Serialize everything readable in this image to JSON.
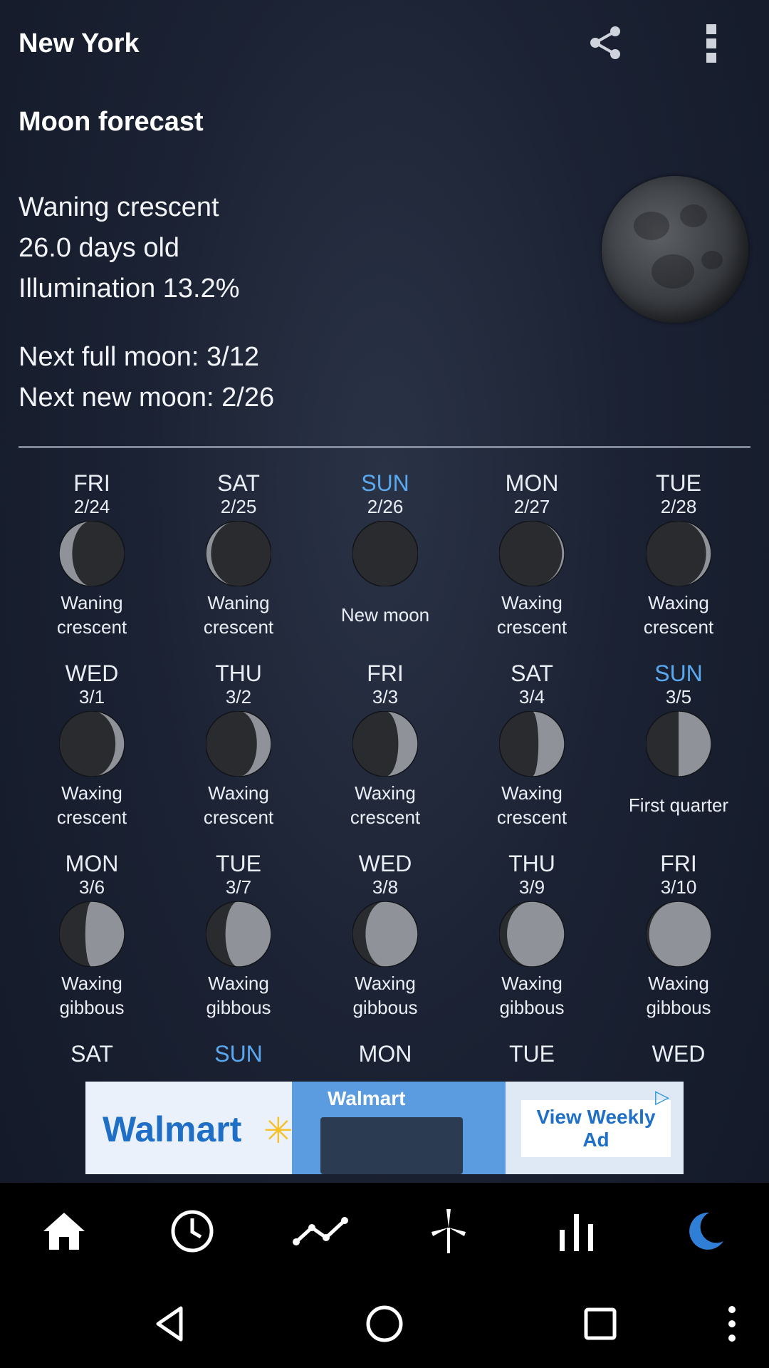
{
  "header": {
    "city": "New York",
    "share_icon": "share-icon",
    "menu_icon": "more-vert-icon"
  },
  "forecast": {
    "title": "Moon forecast",
    "phase": "Waning crescent",
    "age": "26.0 days old",
    "illumination_label": "Illumination",
    "illumination_value": "13.2%",
    "next_full_label": "Next full moon:",
    "next_full_value": "3/12",
    "next_new_label": "Next new moon:",
    "next_new_value": "2/26"
  },
  "days": [
    {
      "day": "FRI",
      "date": "2/24",
      "phase": "Waning crescent",
      "illum": 0.2,
      "waxing": false,
      "sunday": false
    },
    {
      "day": "SAT",
      "date": "2/25",
      "phase": "Waning crescent",
      "illum": 0.08,
      "waxing": false,
      "sunday": false
    },
    {
      "day": "SUN",
      "date": "2/26",
      "phase": "New moon",
      "illum": 0.0,
      "waxing": true,
      "sunday": true
    },
    {
      "day": "MON",
      "date": "2/27",
      "phase": "Waxing crescent",
      "illum": 0.04,
      "waxing": true,
      "sunday": false
    },
    {
      "day": "TUE",
      "date": "2/28",
      "phase": "Waxing crescent",
      "illum": 0.08,
      "waxing": true,
      "sunday": false
    },
    {
      "day": "WED",
      "date": "3/1",
      "phase": "Waxing crescent",
      "illum": 0.14,
      "waxing": true,
      "sunday": false
    },
    {
      "day": "THU",
      "date": "3/2",
      "phase": "Waxing crescent",
      "illum": 0.22,
      "waxing": true,
      "sunday": false
    },
    {
      "day": "FRI",
      "date": "3/3",
      "phase": "Waxing crescent",
      "illum": 0.3,
      "waxing": true,
      "sunday": false
    },
    {
      "day": "SAT",
      "date": "3/4",
      "phase": "Waxing crescent",
      "illum": 0.4,
      "waxing": true,
      "sunday": false
    },
    {
      "day": "SUN",
      "date": "3/5",
      "phase": "First quarter",
      "illum": 0.5,
      "waxing": true,
      "sunday": true
    },
    {
      "day": "MON",
      "date": "3/6",
      "phase": "Waxing gibbous",
      "illum": 0.6,
      "waxing": true,
      "sunday": false
    },
    {
      "day": "TUE",
      "date": "3/7",
      "phase": "Waxing gibbous",
      "illum": 0.7,
      "waxing": true,
      "sunday": false
    },
    {
      "day": "WED",
      "date": "3/8",
      "phase": "Waxing gibbous",
      "illum": 0.8,
      "waxing": true,
      "sunday": false
    },
    {
      "day": "THU",
      "date": "3/9",
      "phase": "Waxing gibbous",
      "illum": 0.88,
      "waxing": true,
      "sunday": false
    },
    {
      "day": "FRI",
      "date": "3/10",
      "phase": "Waxing gibbous",
      "illum": 0.95,
      "waxing": true,
      "sunday": false
    },
    {
      "day": "SAT",
      "date": "",
      "phase": "",
      "illum": null,
      "waxing": true,
      "sunday": false
    },
    {
      "day": "SUN",
      "date": "",
      "phase": "",
      "illum": null,
      "waxing": true,
      "sunday": true
    },
    {
      "day": "MON",
      "date": "",
      "phase": "",
      "illum": null,
      "waxing": true,
      "sunday": false
    },
    {
      "day": "TUE",
      "date": "",
      "phase": "",
      "illum": null,
      "waxing": true,
      "sunday": false
    },
    {
      "day": "WED",
      "date": "",
      "phase": "",
      "illum": null,
      "waxing": true,
      "sunday": false
    }
  ],
  "ad": {
    "brand": "Walmart",
    "button": "View Weekly Ad",
    "icon": "ad-choices-icon"
  },
  "bottom_nav": [
    {
      "name": "home",
      "icon": "home-icon",
      "active": false
    },
    {
      "name": "hourly",
      "icon": "clock-icon",
      "active": false
    },
    {
      "name": "graph",
      "icon": "trend-icon",
      "active": false
    },
    {
      "name": "wind",
      "icon": "wind-turbine-icon",
      "active": false
    },
    {
      "name": "stats",
      "icon": "bars-icon",
      "active": false
    },
    {
      "name": "moon",
      "icon": "moon-icon",
      "active": true
    }
  ],
  "system_nav": [
    "back-icon",
    "home-circle-icon",
    "recents-icon",
    "more-icon"
  ],
  "colors": {
    "accent": "#5aa8f0",
    "background": "#1b2233",
    "nav_bg": "#000000",
    "sunday": "#5aa8f0",
    "moon_active": "#2f7fd6"
  }
}
